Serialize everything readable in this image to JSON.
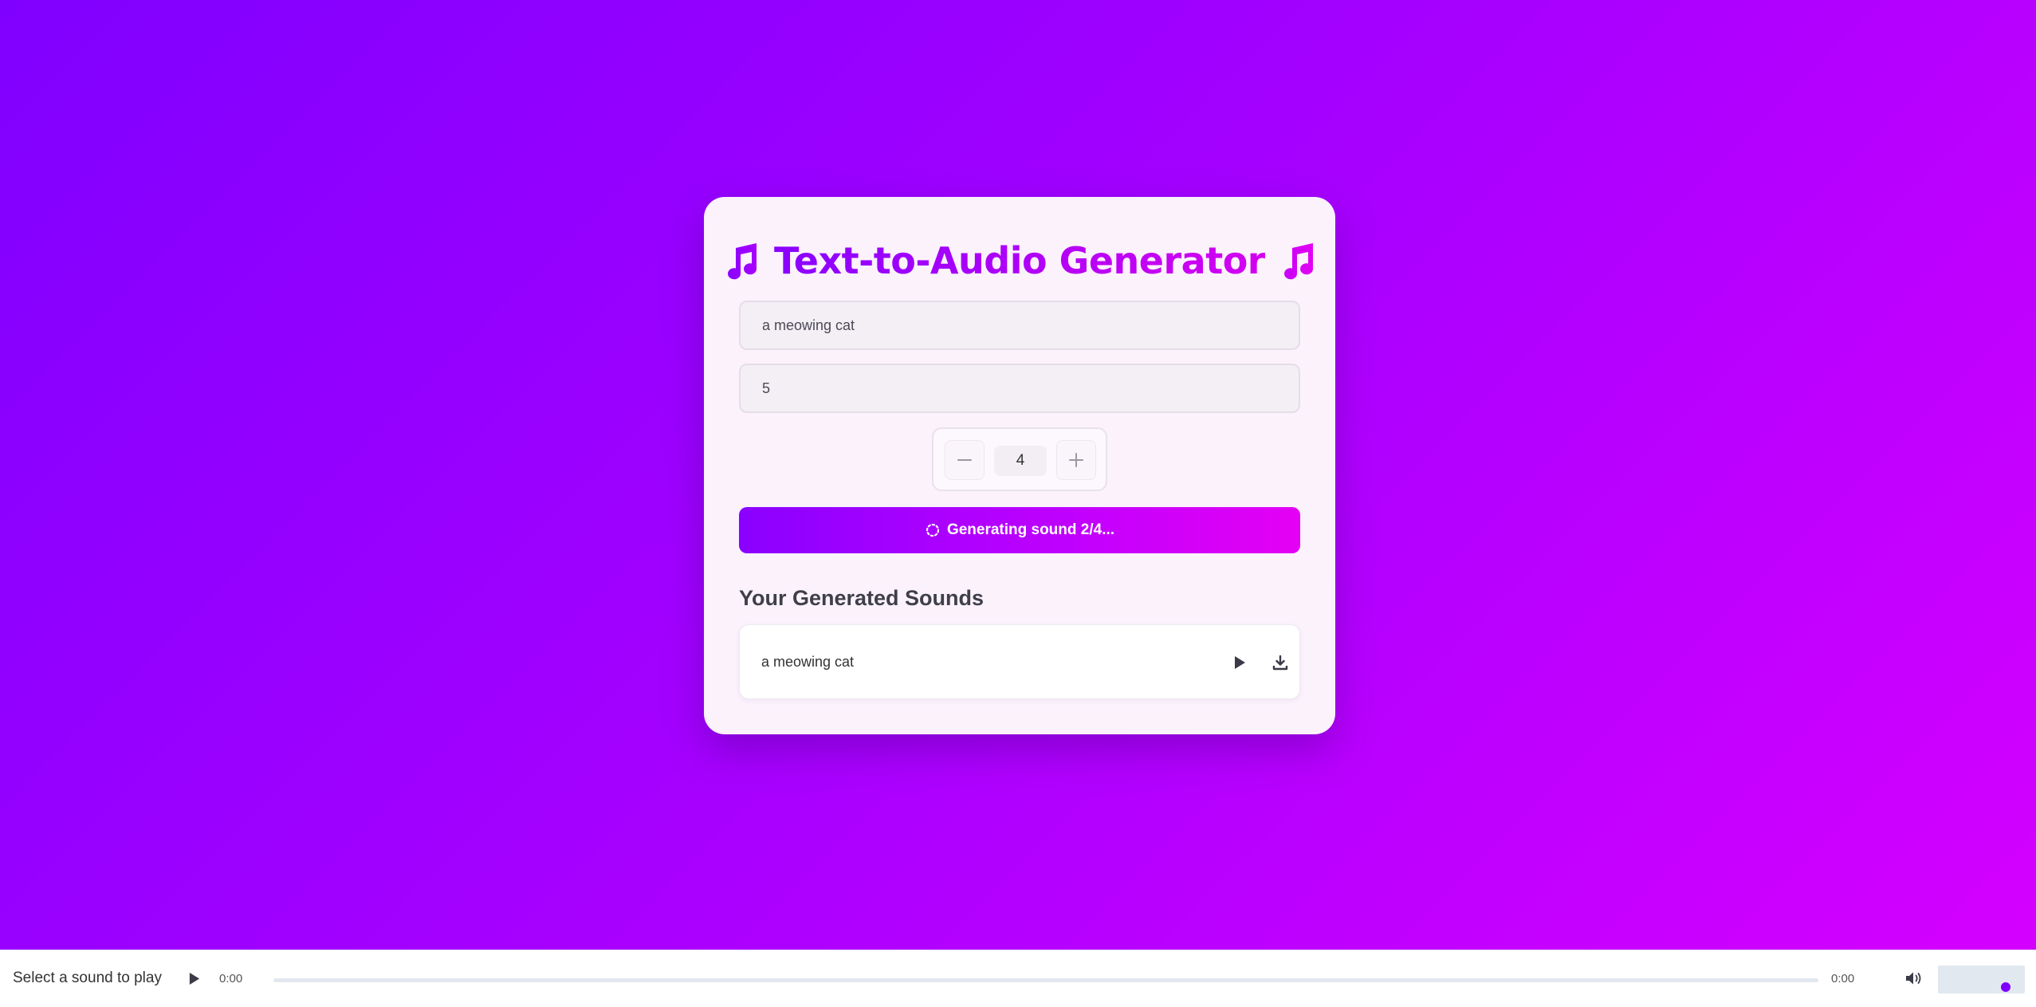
{
  "app": {
    "title": "Text-to-Audio Generator",
    "title_icon": "music-note-icon",
    "accent_start": "#8a00ff",
    "accent_end": "#e400f4"
  },
  "form": {
    "prompt_value": "a meowing cat",
    "duration_value": "5"
  },
  "stepper": {
    "value": "4",
    "minus_icon": "minus-icon",
    "plus_icon": "plus-icon"
  },
  "generate_button": {
    "label": "Generating sound 2/4...",
    "icon": "spinner-icon"
  },
  "sounds": {
    "heading": "Your Generated Sounds",
    "items": [
      {
        "name": "a meowing cat",
        "play_icon": "play-icon",
        "download_icon": "download-icon"
      }
    ]
  },
  "player": {
    "now_playing": "Select a sound to play",
    "current_time": "0:00",
    "duration": "0:00",
    "progress": 0,
    "volume": 0.78
  }
}
